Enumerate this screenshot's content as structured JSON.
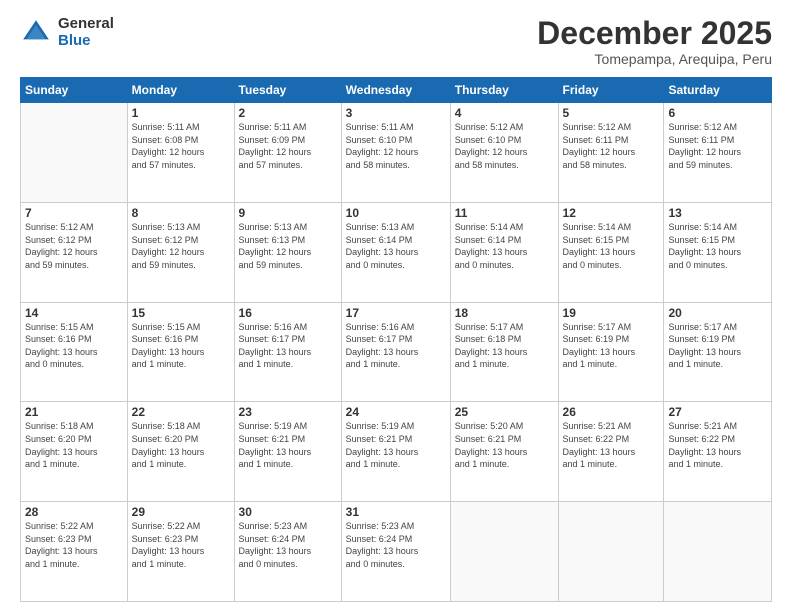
{
  "logo": {
    "general": "General",
    "blue": "Blue"
  },
  "title": "December 2025",
  "subtitle": "Tomepampa, Arequipa, Peru",
  "days_of_week": [
    "Sunday",
    "Monday",
    "Tuesday",
    "Wednesday",
    "Thursday",
    "Friday",
    "Saturday"
  ],
  "weeks": [
    [
      {
        "day": "",
        "info": ""
      },
      {
        "day": "1",
        "info": "Sunrise: 5:11 AM\nSunset: 6:08 PM\nDaylight: 12 hours\nand 57 minutes."
      },
      {
        "day": "2",
        "info": "Sunrise: 5:11 AM\nSunset: 6:09 PM\nDaylight: 12 hours\nand 57 minutes."
      },
      {
        "day": "3",
        "info": "Sunrise: 5:11 AM\nSunset: 6:10 PM\nDaylight: 12 hours\nand 58 minutes."
      },
      {
        "day": "4",
        "info": "Sunrise: 5:12 AM\nSunset: 6:10 PM\nDaylight: 12 hours\nand 58 minutes."
      },
      {
        "day": "5",
        "info": "Sunrise: 5:12 AM\nSunset: 6:11 PM\nDaylight: 12 hours\nand 58 minutes."
      },
      {
        "day": "6",
        "info": "Sunrise: 5:12 AM\nSunset: 6:11 PM\nDaylight: 12 hours\nand 59 minutes."
      }
    ],
    [
      {
        "day": "7",
        "info": "Sunrise: 5:12 AM\nSunset: 6:12 PM\nDaylight: 12 hours\nand 59 minutes."
      },
      {
        "day": "8",
        "info": "Sunrise: 5:13 AM\nSunset: 6:12 PM\nDaylight: 12 hours\nand 59 minutes."
      },
      {
        "day": "9",
        "info": "Sunrise: 5:13 AM\nSunset: 6:13 PM\nDaylight: 12 hours\nand 59 minutes."
      },
      {
        "day": "10",
        "info": "Sunrise: 5:13 AM\nSunset: 6:14 PM\nDaylight: 13 hours\nand 0 minutes."
      },
      {
        "day": "11",
        "info": "Sunrise: 5:14 AM\nSunset: 6:14 PM\nDaylight: 13 hours\nand 0 minutes."
      },
      {
        "day": "12",
        "info": "Sunrise: 5:14 AM\nSunset: 6:15 PM\nDaylight: 13 hours\nand 0 minutes."
      },
      {
        "day": "13",
        "info": "Sunrise: 5:14 AM\nSunset: 6:15 PM\nDaylight: 13 hours\nand 0 minutes."
      }
    ],
    [
      {
        "day": "14",
        "info": "Sunrise: 5:15 AM\nSunset: 6:16 PM\nDaylight: 13 hours\nand 0 minutes."
      },
      {
        "day": "15",
        "info": "Sunrise: 5:15 AM\nSunset: 6:16 PM\nDaylight: 13 hours\nand 1 minute."
      },
      {
        "day": "16",
        "info": "Sunrise: 5:16 AM\nSunset: 6:17 PM\nDaylight: 13 hours\nand 1 minute."
      },
      {
        "day": "17",
        "info": "Sunrise: 5:16 AM\nSunset: 6:17 PM\nDaylight: 13 hours\nand 1 minute."
      },
      {
        "day": "18",
        "info": "Sunrise: 5:17 AM\nSunset: 6:18 PM\nDaylight: 13 hours\nand 1 minute."
      },
      {
        "day": "19",
        "info": "Sunrise: 5:17 AM\nSunset: 6:19 PM\nDaylight: 13 hours\nand 1 minute."
      },
      {
        "day": "20",
        "info": "Sunrise: 5:17 AM\nSunset: 6:19 PM\nDaylight: 13 hours\nand 1 minute."
      }
    ],
    [
      {
        "day": "21",
        "info": "Sunrise: 5:18 AM\nSunset: 6:20 PM\nDaylight: 13 hours\nand 1 minute."
      },
      {
        "day": "22",
        "info": "Sunrise: 5:18 AM\nSunset: 6:20 PM\nDaylight: 13 hours\nand 1 minute."
      },
      {
        "day": "23",
        "info": "Sunrise: 5:19 AM\nSunset: 6:21 PM\nDaylight: 13 hours\nand 1 minute."
      },
      {
        "day": "24",
        "info": "Sunrise: 5:19 AM\nSunset: 6:21 PM\nDaylight: 13 hours\nand 1 minute."
      },
      {
        "day": "25",
        "info": "Sunrise: 5:20 AM\nSunset: 6:21 PM\nDaylight: 13 hours\nand 1 minute."
      },
      {
        "day": "26",
        "info": "Sunrise: 5:21 AM\nSunset: 6:22 PM\nDaylight: 13 hours\nand 1 minute."
      },
      {
        "day": "27",
        "info": "Sunrise: 5:21 AM\nSunset: 6:22 PM\nDaylight: 13 hours\nand 1 minute."
      }
    ],
    [
      {
        "day": "28",
        "info": "Sunrise: 5:22 AM\nSunset: 6:23 PM\nDaylight: 13 hours\nand 1 minute."
      },
      {
        "day": "29",
        "info": "Sunrise: 5:22 AM\nSunset: 6:23 PM\nDaylight: 13 hours\nand 1 minute."
      },
      {
        "day": "30",
        "info": "Sunrise: 5:23 AM\nSunset: 6:24 PM\nDaylight: 13 hours\nand 0 minutes."
      },
      {
        "day": "31",
        "info": "Sunrise: 5:23 AM\nSunset: 6:24 PM\nDaylight: 13 hours\nand 0 minutes."
      },
      {
        "day": "",
        "info": ""
      },
      {
        "day": "",
        "info": ""
      },
      {
        "day": "",
        "info": ""
      }
    ]
  ]
}
